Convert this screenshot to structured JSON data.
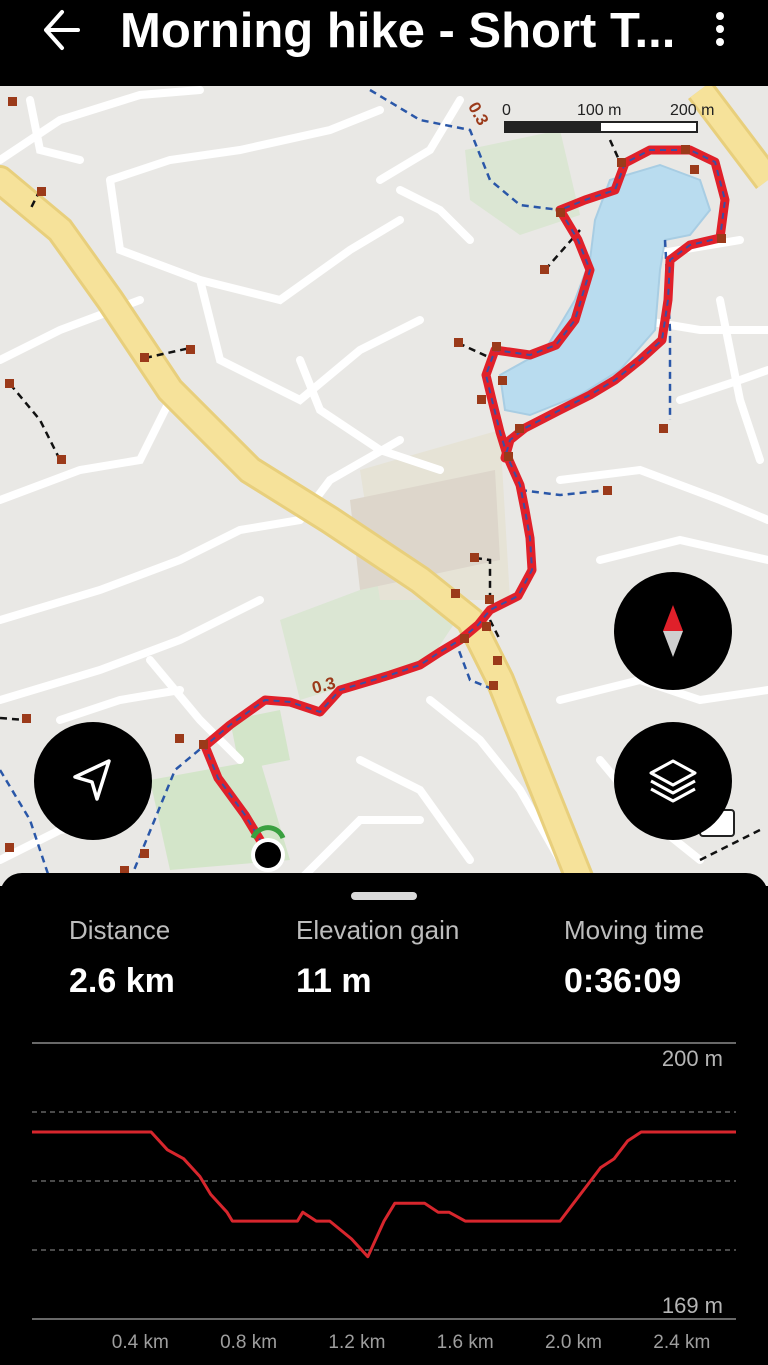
{
  "header": {
    "title": "Morning hike - Short T...",
    "back_icon": "arrow-left-icon",
    "menu_icon": "more-vertical-icon"
  },
  "map": {
    "scale": {
      "zero": "0",
      "mid": "100 m",
      "max": "200 m"
    },
    "route_markers": [
      "0.3",
      "0.3"
    ],
    "route_color": "#e0202a",
    "lake_color": "#b9dcef",
    "buttons": {
      "locate_icon": "navigation-arrow-icon",
      "compass_icon": "compass-icon",
      "layers_icon": "layers-icon"
    }
  },
  "stats": {
    "distance": {
      "label": "Distance",
      "value": "2.6 km"
    },
    "elevation": {
      "label": "Elevation gain",
      "value": "11 m"
    },
    "moving": {
      "label": "Moving time",
      "value": "0:36:09"
    }
  },
  "chart_data": {
    "type": "line",
    "title": "",
    "xlabel": "",
    "ylabel": "",
    "y_top_label": "200 m",
    "y_bottom_label": "169 m",
    "ylim": [
      169,
      200
    ],
    "xlim": [
      0,
      2.6
    ],
    "x_ticks": [
      "0.4 km",
      "0.8 km",
      "1.2 km",
      "1.6 km",
      "2.0 km",
      "2.4 km"
    ],
    "x_tick_values": [
      0.4,
      0.8,
      1.2,
      1.6,
      2.0,
      2.4
    ],
    "grid": true,
    "color": "#d7262d",
    "series": [
      {
        "x": [
          0,
          0.44,
          0.5,
          0.56,
          0.62,
          0.66,
          0.72,
          0.74,
          0.8,
          0.9,
          0.98,
          1.0,
          1.05,
          1.1,
          1.18,
          1.24,
          1.3,
          1.34,
          1.38,
          1.45,
          1.5,
          1.54,
          1.6,
          1.7,
          1.8,
          1.88,
          1.95,
          2.0,
          2.05,
          2.1,
          2.15,
          2.2,
          2.25,
          2.3,
          2.6
        ],
        "y": [
          190,
          190,
          188,
          187,
          185,
          183,
          181,
          180,
          180,
          180,
          180,
          181,
          180,
          180,
          178,
          176,
          180,
          182,
          182,
          182,
          181,
          181,
          180,
          180,
          180,
          180,
          180,
          182,
          184,
          186,
          187,
          189,
          190,
          190,
          190
        ]
      }
    ]
  }
}
